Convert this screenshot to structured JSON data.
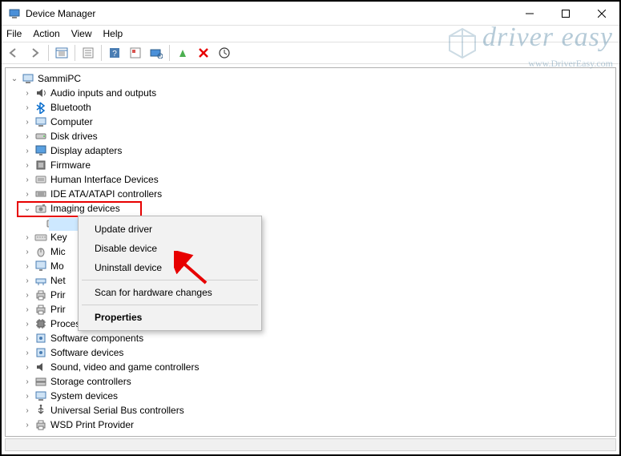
{
  "window": {
    "title": "Device Manager",
    "computer_name": "SammiPC"
  },
  "menu": {
    "file": "File",
    "action": "Action",
    "view": "View",
    "help": "Help"
  },
  "watermark": {
    "main": "driver easy",
    "sub": "www.DriverEasy.com"
  },
  "devices": [
    {
      "label": "Audio inputs and outputs",
      "icon": "audio-icon"
    },
    {
      "label": "Bluetooth",
      "icon": "bluetooth-icon"
    },
    {
      "label": "Computer",
      "icon": "computer-icon"
    },
    {
      "label": "Disk drives",
      "icon": "disk-icon"
    },
    {
      "label": "Display adapters",
      "icon": "display-icon"
    },
    {
      "label": "Firmware",
      "icon": "firmware-icon"
    },
    {
      "label": "Human Interface Devices",
      "icon": "hid-icon"
    },
    {
      "label": "IDE ATA/ATAPI controllers",
      "icon": "ide-icon"
    },
    {
      "label": "Imaging devices",
      "icon": "imaging-icon",
      "expanded": true,
      "highlighted": true
    },
    {
      "label": "Key",
      "icon": "keyboard-icon",
      "truncated": true
    },
    {
      "label": "Mic",
      "icon": "mouse-icon",
      "truncated": true
    },
    {
      "label": "Mo",
      "icon": "monitor-icon",
      "truncated": true
    },
    {
      "label": "Net",
      "icon": "network-icon",
      "truncated": true
    },
    {
      "label": "Prir",
      "icon": "printqueue-icon",
      "truncated": true
    },
    {
      "label": "Prir",
      "icon": "printer-icon",
      "truncated": true
    },
    {
      "label": "Processors",
      "icon": "processor-icon"
    },
    {
      "label": "Software components",
      "icon": "software-icon"
    },
    {
      "label": "Software devices",
      "icon": "software-icon"
    },
    {
      "label": "Sound, video and game controllers",
      "icon": "sound-icon"
    },
    {
      "label": "Storage controllers",
      "icon": "storage-icon"
    },
    {
      "label": "System devices",
      "icon": "system-icon"
    },
    {
      "label": "Universal Serial Bus controllers",
      "icon": "usb-icon"
    },
    {
      "label": "WSD Print Provider",
      "icon": "printer-icon"
    }
  ],
  "context_menu": {
    "update": "Update driver",
    "disable": "Disable device",
    "uninstall": "Uninstall device",
    "scan": "Scan for hardware changes",
    "properties": "Properties"
  },
  "icons": {
    "audio": "🔊",
    "bluetooth_color": "#0a6ecd",
    "disk": "🖴",
    "display": "🖥",
    "keyboard": "⌨",
    "mouse": "🖱",
    "monitor": "🖥",
    "network": "🖧",
    "printer": "🖨",
    "processor": "▦",
    "sound": "🔉",
    "usb": "⑂"
  }
}
